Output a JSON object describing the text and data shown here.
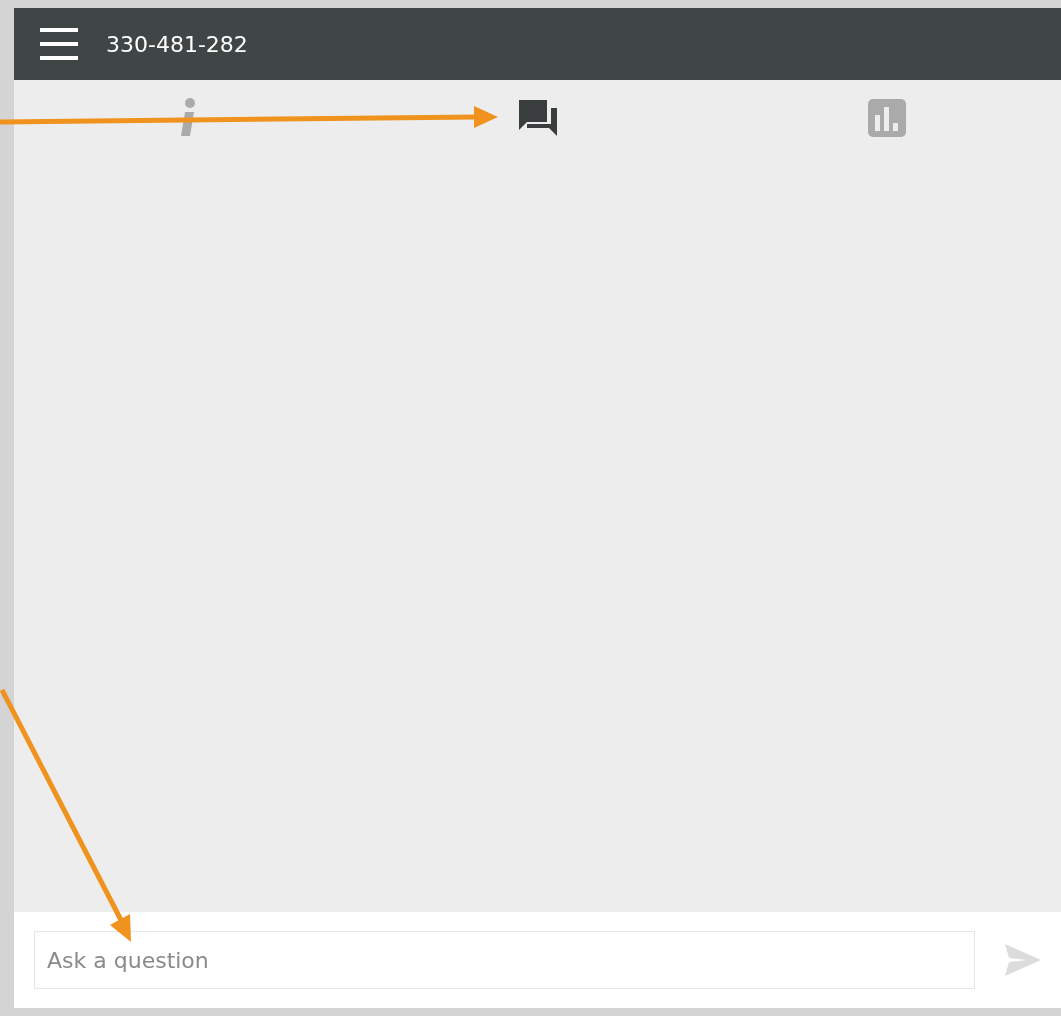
{
  "header": {
    "title": "330-481-282"
  },
  "tabs": [
    {
      "kind": "info",
      "selected": false
    },
    {
      "kind": "chat",
      "selected": true
    },
    {
      "kind": "stats",
      "selected": false
    }
  ],
  "composer": {
    "placeholder": "Ask a question"
  },
  "annotations": [
    {
      "kind": "arrow"
    },
    {
      "kind": "arrow"
    }
  ]
}
